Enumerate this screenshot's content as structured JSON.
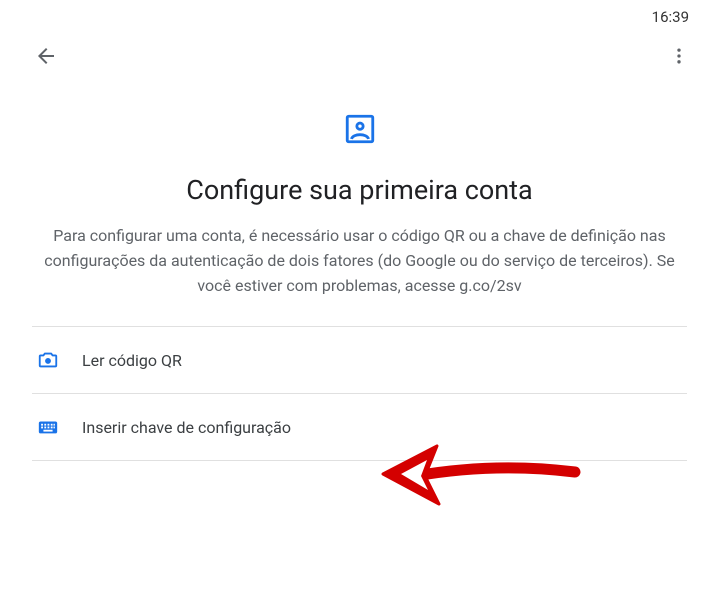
{
  "statusBar": {
    "time": "16:39"
  },
  "header": {
    "title": "Configure sua primeira conta",
    "subtitle": "Para configurar uma conta, é necessário usar o código QR ou a chave de definição nas configurações da autenticação de dois fatores (do Google ou do serviço de terceiros). Se você estiver com problemas, acesse g.co/2sv"
  },
  "options": {
    "scanQr": {
      "label": "Ler código QR"
    },
    "enterKey": {
      "label": "Inserir chave de configuração"
    }
  }
}
